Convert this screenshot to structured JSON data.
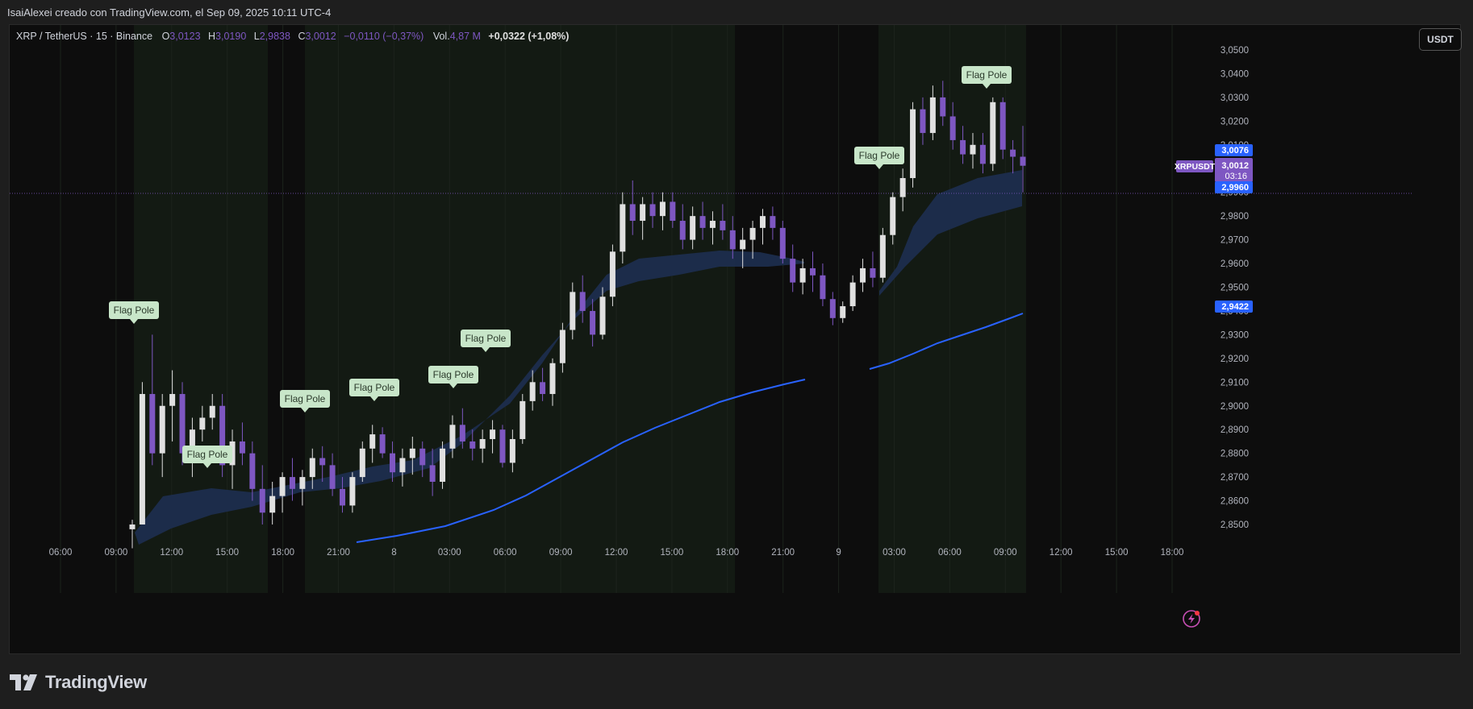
{
  "caption": "IsaiAlexei creado con TradingView.com, el Sep 09, 2025 10:11 UTC-4",
  "legend": {
    "symbol": "XRP / TetherUS · 15 · Binance",
    "o_label": "O",
    "o_value": "3,0123",
    "h_label": "H",
    "h_value": "3,0190",
    "l_label": "L",
    "l_value": "2,9838",
    "c_label": "C",
    "c_value": "3,0012",
    "change": "−0,0110 (−0,37%)",
    "vol_label": "Vol.",
    "vol_value": "4,87 M",
    "extra_change": "+0,0322 (+1,08%)"
  },
  "currency_button": "USDT",
  "price_scale": [
    "3,0500",
    "3,0400",
    "3,0300",
    "3,0200",
    "3,0100",
    "3,0000",
    "2,9900",
    "2,9800",
    "2,9700",
    "2,9600",
    "2,9500",
    "2,9400",
    "2,9300",
    "2,9200",
    "2,9100",
    "2,9000",
    "2,8900",
    "2,8800",
    "2,8700",
    "2,8600",
    "2,8500"
  ],
  "time_axis": [
    "06:00",
    "09:00",
    "12:00",
    "15:00",
    "18:00",
    "21:00",
    "8",
    "03:00",
    "06:00",
    "09:00",
    "12:00",
    "15:00",
    "18:00",
    "21:00",
    "9",
    "03:00",
    "06:00",
    "09:00",
    "12:00",
    "15:00",
    "18:00"
  ],
  "price_tags": {
    "symbol_tag": "XRPUSDT",
    "last_price": "3,0012",
    "countdown": "03:16",
    "upper_band": "3,0076",
    "lower_band": "2,9960",
    "long_ma": "2,9422"
  },
  "annotations": [
    "Flag Pole",
    "Flag Pole",
    "Flag Pole",
    "Flag Pole",
    "Flag Pole",
    "Flag Pole",
    "Flag Pole",
    "Flag Pole"
  ],
  "footer_logo": "TradingView",
  "colors": {
    "background": "#0d0d0d",
    "session_shade": "#131a13",
    "bull_candle": "#e0e0e0",
    "bear_candle": "#7e57c2",
    "band_fill": "#1c2d4d",
    "ma_line": "#2962ff",
    "label_bg": "#c8e6c9",
    "last_price_tag": "#7e57c2",
    "band_tag": "#2962ff"
  },
  "chart_data": {
    "type": "candlestick",
    "title": "XRP / TetherUS · 15 · Binance",
    "ylim": [
      2.845,
      3.055
    ],
    "y_ticks": [
      2.85,
      2.86,
      2.87,
      2.88,
      2.89,
      2.9,
      2.91,
      2.92,
      2.93,
      2.94,
      2.95,
      2.96,
      2.97,
      2.98,
      2.99,
      3.0,
      3.01,
      3.02,
      3.03,
      3.04,
      3.05
    ],
    "last_price": 3.0012,
    "band_last": [
      2.996,
      3.0076
    ],
    "ma_last": 2.9422,
    "candles_ohlc": [
      [
        2.848,
        2.852,
        2.84,
        2.85
      ],
      [
        2.85,
        2.91,
        2.85,
        2.905
      ],
      [
        2.905,
        2.93,
        2.875,
        2.88
      ],
      [
        2.88,
        2.905,
        2.87,
        2.9
      ],
      [
        2.9,
        2.915,
        2.885,
        2.905
      ],
      [
        2.905,
        2.91,
        2.875,
        2.88
      ],
      [
        2.88,
        2.895,
        2.87,
        2.89
      ],
      [
        2.89,
        2.9,
        2.885,
        2.895
      ],
      [
        2.895,
        2.905,
        2.89,
        2.9
      ],
      [
        2.9,
        2.905,
        2.87,
        2.875
      ],
      [
        2.875,
        2.89,
        2.865,
        2.885
      ],
      [
        2.885,
        2.893,
        2.875,
        2.88
      ],
      [
        2.88,
        2.885,
        2.86,
        2.865
      ],
      [
        2.865,
        2.875,
        2.85,
        2.855
      ],
      [
        2.855,
        2.868,
        2.85,
        2.862
      ],
      [
        2.862,
        2.872,
        2.855,
        2.87
      ],
      [
        2.87,
        2.878,
        2.86,
        2.865
      ],
      [
        2.865,
        2.873,
        2.858,
        2.87
      ],
      [
        2.87,
        2.882,
        2.865,
        2.878
      ],
      [
        2.878,
        2.883,
        2.868,
        2.875
      ],
      [
        2.875,
        2.88,
        2.862,
        2.865
      ],
      [
        2.865,
        2.87,
        2.855,
        2.858
      ],
      [
        2.858,
        2.872,
        2.855,
        2.87
      ],
      [
        2.87,
        2.885,
        2.868,
        2.882
      ],
      [
        2.882,
        2.892,
        2.876,
        2.888
      ],
      [
        2.888,
        2.891,
        2.878,
        2.88
      ],
      [
        2.88,
        2.885,
        2.868,
        2.872
      ],
      [
        2.872,
        2.882,
        2.866,
        2.878
      ],
      [
        2.878,
        2.887,
        2.871,
        2.882
      ],
      [
        2.882,
        2.885,
        2.87,
        2.875
      ],
      [
        2.875,
        2.882,
        2.862,
        2.868
      ],
      [
        2.868,
        2.885,
        2.865,
        2.882
      ],
      [
        2.882,
        2.896,
        2.878,
        2.892
      ],
      [
        2.892,
        2.899,
        2.882,
        2.885
      ],
      [
        2.885,
        2.89,
        2.877,
        2.882
      ],
      [
        2.882,
        2.89,
        2.876,
        2.886
      ],
      [
        2.886,
        2.894,
        2.88,
        2.89
      ],
      [
        2.89,
        2.892,
        2.874,
        2.876
      ],
      [
        2.876,
        2.89,
        2.872,
        2.886
      ],
      [
        2.886,
        2.905,
        2.884,
        2.902
      ],
      [
        2.902,
        2.915,
        2.898,
        2.91
      ],
      [
        2.91,
        2.916,
        2.902,
        2.905
      ],
      [
        2.905,
        2.92,
        2.9,
        2.918
      ],
      [
        2.918,
        2.935,
        2.914,
        2.932
      ],
      [
        2.932,
        2.952,
        2.928,
        2.948
      ],
      [
        2.948,
        2.955,
        2.935,
        2.94
      ],
      [
        2.94,
        2.945,
        2.925,
        2.93
      ],
      [
        2.93,
        2.95,
        2.928,
        2.946
      ],
      [
        2.946,
        2.968,
        2.942,
        2.965
      ],
      [
        2.965,
        2.99,
        2.96,
        2.985
      ],
      [
        2.985,
        2.995,
        2.972,
        2.978
      ],
      [
        2.978,
        2.988,
        2.97,
        2.985
      ],
      [
        2.985,
        2.99,
        2.975,
        2.98
      ],
      [
        2.98,
        2.99,
        2.974,
        2.986
      ],
      [
        2.986,
        2.99,
        2.975,
        2.978
      ],
      [
        2.978,
        2.985,
        2.966,
        2.97
      ],
      [
        2.97,
        2.984,
        2.966,
        2.98
      ],
      [
        2.98,
        2.986,
        2.97,
        2.975
      ],
      [
        2.975,
        2.982,
        2.968,
        2.978
      ],
      [
        2.978,
        2.985,
        2.97,
        2.974
      ],
      [
        2.974,
        2.98,
        2.962,
        2.966
      ],
      [
        2.966,
        2.975,
        2.958,
        2.97
      ],
      [
        2.97,
        2.978,
        2.962,
        2.975
      ],
      [
        2.975,
        2.983,
        2.968,
        2.98
      ],
      [
        2.98,
        2.984,
        2.97,
        2.975
      ],
      [
        2.975,
        2.978,
        2.96,
        2.962
      ],
      [
        2.962,
        2.968,
        2.948,
        2.952
      ],
      [
        2.952,
        2.962,
        2.947,
        2.958
      ],
      [
        2.958,
        2.965,
        2.948,
        2.955
      ],
      [
        2.955,
        2.96,
        2.942,
        2.945
      ],
      [
        2.945,
        2.948,
        2.934,
        2.937
      ],
      [
        2.937,
        2.944,
        2.935,
        2.942
      ],
      [
        2.942,
        2.955,
        2.94,
        2.952
      ],
      [
        2.952,
        2.962,
        2.948,
        2.958
      ],
      [
        2.958,
        2.965,
        2.95,
        2.954
      ],
      [
        2.954,
        2.975,
        2.952,
        2.972
      ],
      [
        2.972,
        2.99,
        2.968,
        2.988
      ],
      [
        2.988,
        3.0,
        2.982,
        2.996
      ],
      [
        2.996,
        3.028,
        2.992,
        3.025
      ],
      [
        3.025,
        3.03,
        3.01,
        3.015
      ],
      [
        3.015,
        3.035,
        3.012,
        3.03
      ],
      [
        3.03,
        3.037,
        3.018,
        3.022
      ],
      [
        3.022,
        3.028,
        3.008,
        3.012
      ],
      [
        3.012,
        3.018,
        3.002,
        3.006
      ],
      [
        3.006,
        3.015,
        3.0,
        3.01
      ],
      [
        3.01,
        3.015,
        2.998,
        3.002
      ],
      [
        3.002,
        3.03,
        2.999,
        3.028
      ],
      [
        3.028,
        3.03,
        3.004,
        3.008
      ],
      [
        3.008,
        3.012,
        2.998,
        3.005
      ],
      [
        3.005,
        3.018,
        2.99,
        3.0012
      ]
    ]
  }
}
